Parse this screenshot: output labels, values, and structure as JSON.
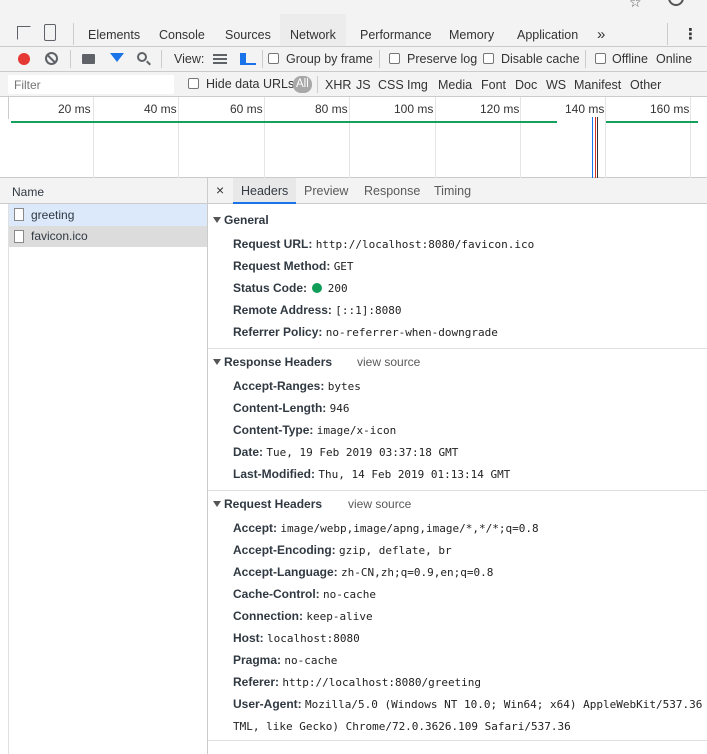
{
  "toolbar": {
    "tabs": [
      "Elements",
      "Console",
      "Sources",
      "Network",
      "Performance",
      "Memory",
      "Application"
    ],
    "active_tab": "Network",
    "more": "»",
    "kebab": "⋮"
  },
  "controls": {
    "view_label": "View:",
    "group_by_frame": "Group by frame",
    "preserve_log": "Preserve log",
    "disable_cache": "Disable cache",
    "offline": "Offline",
    "online": "Online"
  },
  "filter": {
    "placeholder": "Filter",
    "hide_data_urls": "Hide data URLs",
    "types": [
      "All",
      "XHR",
      "JS",
      "CSS",
      "Img",
      "Media",
      "Font",
      "Doc",
      "WS",
      "Manifest",
      "Other"
    ]
  },
  "timeline": {
    "ticks": [
      "20 ms",
      "40 ms",
      "60 ms",
      "80 ms",
      "100 ms",
      "120 ms",
      "140 ms",
      "160 ms"
    ]
  },
  "requests": {
    "header": "Name",
    "items": [
      "greeting",
      "favicon.ico"
    ]
  },
  "details": {
    "close": "×",
    "tabs": [
      "Headers",
      "Preview",
      "Response",
      "Timing"
    ],
    "active_tab": "Headers",
    "view_source": "view source",
    "general": {
      "title": "General",
      "rows": [
        {
          "name": "Request URL:",
          "value": "http://localhost:8080/favicon.ico"
        },
        {
          "name": "Request Method:",
          "value": "GET"
        },
        {
          "name": "Status Code:",
          "value": "200"
        },
        {
          "name": "Remote Address:",
          "value": "[::1]:8080"
        },
        {
          "name": "Referrer Policy:",
          "value": "no-referrer-when-downgrade"
        }
      ]
    },
    "response": {
      "title": "Response Headers",
      "rows": [
        {
          "name": "Accept-Ranges:",
          "value": "bytes"
        },
        {
          "name": "Content-Length:",
          "value": "946"
        },
        {
          "name": "Content-Type:",
          "value": "image/x-icon"
        },
        {
          "name": "Date:",
          "value": "Tue, 19 Feb 2019 03:37:18 GMT"
        },
        {
          "name": "Last-Modified:",
          "value": "Thu, 14 Feb 2019 01:13:14 GMT"
        }
      ]
    },
    "request": {
      "title": "Request Headers",
      "rows": [
        {
          "name": "Accept:",
          "value": "image/webp,image/apng,image/*,*/*;q=0.8"
        },
        {
          "name": "Accept-Encoding:",
          "value": "gzip, deflate, br"
        },
        {
          "name": "Accept-Language:",
          "value": "zh-CN,zh;q=0.9,en;q=0.8"
        },
        {
          "name": "Cache-Control:",
          "value": "no-cache"
        },
        {
          "name": "Connection:",
          "value": "keep-alive"
        },
        {
          "name": "Host:",
          "value": "localhost:8080"
        },
        {
          "name": "Pragma:",
          "value": "no-cache"
        },
        {
          "name": "Referer:",
          "value": "http://localhost:8080/greeting"
        },
        {
          "name": "User-Agent:",
          "value": "Mozilla/5.0 (Windows NT 10.0; Win64; x64) AppleWebKit/537.36"
        }
      ],
      "wrap": "TML, like Gecko) Chrome/72.0.3626.109 Safari/537.36"
    }
  },
  "colors": {
    "accent": "#1a73e8",
    "record": "#e53935",
    "status_ok": "#0f9d58",
    "timeline_green": "#13a05a"
  }
}
